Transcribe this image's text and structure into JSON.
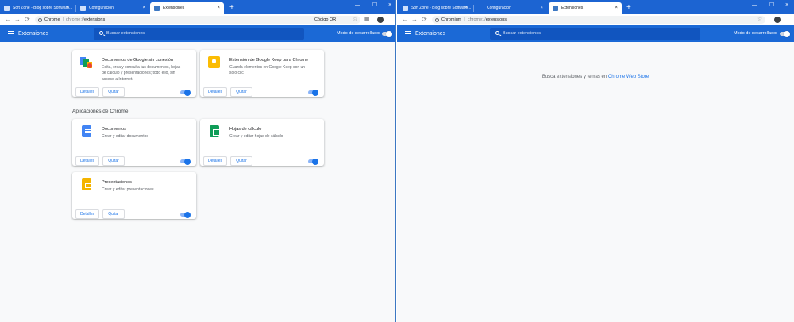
{
  "left_window": {
    "tabs": [
      {
        "label": "Soft Zone - Blog sobre Software...",
        "active": false
      },
      {
        "label": "Configuración",
        "active": false
      },
      {
        "label": "Extensiones",
        "active": true
      }
    ],
    "url": {
      "site": "Chrome",
      "path_prefix": "chrome://",
      "path": "extensions"
    },
    "qr_label": "Código QR",
    "header": {
      "title": "Extensiones",
      "search_placeholder": "Buscar extensiones",
      "dev_mode_label": "Modo de desarrollador",
      "dev_mode_on": false
    },
    "extensions": [
      {
        "name": "Documentos de Google sin conexión",
        "description": "Edita, crea y consulta tus documentos, hojas de cálculo y presentaciones; todo ello, sin acceso a Internet.",
        "icon": "docs-offline-icon",
        "enabled": true
      },
      {
        "name": "Extensión de Google Keep para Chrome",
        "description": "Guarda elementos en Google Keep con un solo clic",
        "icon": "keep-icon",
        "enabled": true
      }
    ],
    "apps_section_title": "Aplicaciones de Chrome",
    "apps": [
      {
        "name": "Documentos",
        "description": "Crear y editar documentos",
        "icon": "docs-icon",
        "enabled": true
      },
      {
        "name": "Hojas de cálculo",
        "description": "Crear y editar hojas de cálculo",
        "icon": "sheets-icon",
        "enabled": true
      },
      {
        "name": "Presentaciones",
        "description": "Crear y editar presentaciones",
        "icon": "slides-icon",
        "enabled": true
      }
    ],
    "details_label": "Detalles",
    "remove_label": "Quitar"
  },
  "right_window": {
    "tabs": [
      {
        "label": "Soft Zone - Blog sobre Software...",
        "active": false
      },
      {
        "label": "Configuración",
        "active": false
      },
      {
        "label": "Extensiones",
        "active": true
      }
    ],
    "url": {
      "site": "Chromium",
      "path_prefix": "chrome://",
      "path": "extensions"
    },
    "header": {
      "title": "Extensiones",
      "search_placeholder": "Buscar extensiones",
      "dev_mode_label": "Modo de desarrollador",
      "dev_mode_on": false
    },
    "empty_message": "Busca extensiones y temas en",
    "empty_link": "Chrome Web Store"
  },
  "colors": {
    "tabstrip": "#1c64d2",
    "header": "#1b69d6",
    "accent": "#1a73e8",
    "page_bg": "#f8f9fa"
  },
  "icons": {
    "close": "×",
    "new_tab": "+",
    "minimize": "—",
    "maximize": "☐",
    "back": "←",
    "forward": "→",
    "reload": "⟳",
    "star": "☆",
    "menu": "⋮"
  }
}
